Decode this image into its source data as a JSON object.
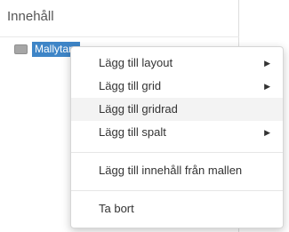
{
  "panel": {
    "title": "Innehåll"
  },
  "tree": {
    "selected_node_label": "Mallytan"
  },
  "context_menu": {
    "group1": [
      {
        "label": "Lägg till layout",
        "submenu_arrow": "▶",
        "highlighted": false
      },
      {
        "label": "Lägg till grid",
        "submenu_arrow": "▶",
        "highlighted": false
      },
      {
        "label": "Lägg till gridrad",
        "submenu_arrow": "",
        "highlighted": true
      },
      {
        "label": "Lägg till spalt",
        "submenu_arrow": "▶",
        "highlighted": false
      }
    ],
    "group2": [
      {
        "label": "Lägg till innehåll från mallen"
      }
    ],
    "group3": [
      {
        "label": "Ta bort"
      }
    ]
  },
  "colors": {
    "selection": "#3e85c7",
    "menu_highlight": "#f3f3f3"
  }
}
